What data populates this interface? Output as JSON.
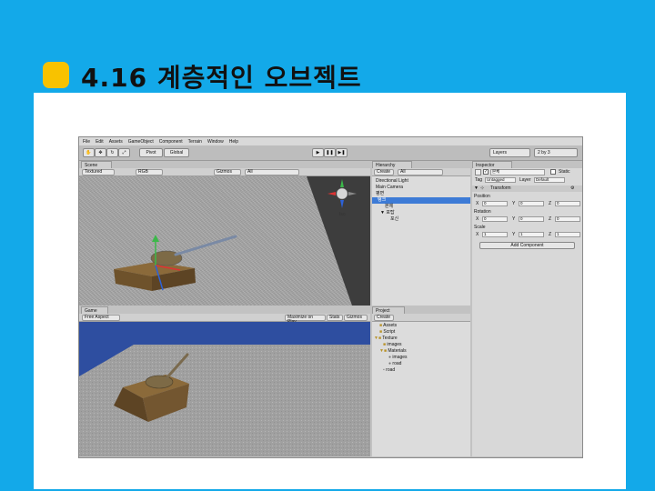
{
  "slide": {
    "title": "4.16 계층적인 오브젝트"
  },
  "colors": {
    "background": "#13a9e9",
    "marker": "#f8c200",
    "selection": "#3d7bd6",
    "sky": "#2e4ea0"
  },
  "menu": [
    "File",
    "Edit",
    "Assets",
    "GameObject",
    "Component",
    "Terrain",
    "Window",
    "Help"
  ],
  "toolbar": {
    "pivot": "Pivot",
    "global": "Global",
    "layers": "Layers",
    "layout": "2 by 3"
  },
  "scene": {
    "tab": "Scene",
    "mode": "Textured",
    "color_mode": "RGB",
    "gizmos": "Gizmos",
    "search": "All",
    "persp": "Iso"
  },
  "game": {
    "tab": "Game",
    "aspect": "Free Aspect",
    "maximize": "Maximize on Play",
    "stats": "Stats",
    "gizmos": "Gizmos"
  },
  "hierarchy": {
    "tab": "Hierarchy",
    "create": "Create",
    "search": "All",
    "items": [
      "Directional Light",
      "Main Camera",
      "평면",
      "탱크",
      "본체",
      "▼ 포탑",
      "포신"
    ]
  },
  "project": {
    "tab": "Project",
    "create": "Create",
    "items": [
      "Assets",
      "Script",
      "Texture",
      "images",
      "Materials",
      "images",
      "road",
      "road"
    ]
  },
  "inspector": {
    "tab": "Inspector",
    "object_name": "본체",
    "static": "Static",
    "tag_label": "Tag",
    "tag_value": "Untagged",
    "layer_label": "Layer",
    "layer_value": "Default",
    "component": "Transform",
    "position_label": "Position",
    "rotation_label": "Rotation",
    "scale_label": "Scale",
    "position": {
      "x": "0",
      "y": "0",
      "z": "0"
    },
    "rotation": {
      "x": "0",
      "y": "0",
      "z": "0"
    },
    "scale": {
      "x": "1",
      "y": "1",
      "z": "1"
    },
    "add_component": "Add Component"
  }
}
